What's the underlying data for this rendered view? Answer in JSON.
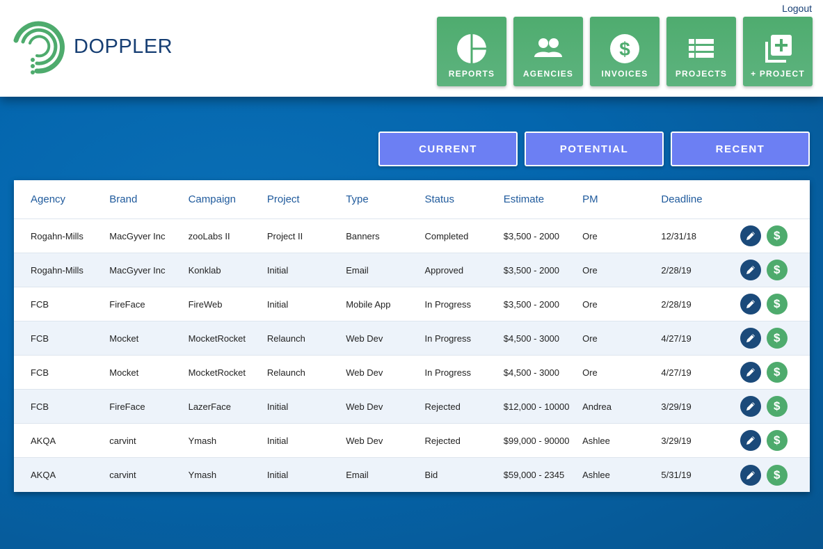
{
  "header": {
    "logout_label": "Logout",
    "logo_text": "DOPPLER",
    "nav": [
      {
        "label": "REPORTS",
        "icon": "pie-chart-icon"
      },
      {
        "label": "AGENCIES",
        "icon": "people-icon"
      },
      {
        "label": "INVOICES",
        "icon": "dollar-icon"
      },
      {
        "label": "PROJECTS",
        "icon": "list-icon"
      },
      {
        "label": "+ PROJECT",
        "icon": "add-project-icon"
      }
    ]
  },
  "tabs": [
    {
      "label": "CURRENT"
    },
    {
      "label": "POTENTIAL"
    },
    {
      "label": "RECENT"
    }
  ],
  "table": {
    "columns": [
      "Agency",
      "Brand",
      "Campaign",
      "Project",
      "Type",
      "Status",
      "Estimate",
      "PM",
      "Deadline"
    ],
    "rows": [
      [
        "Rogahn-Mills",
        "MacGyver Inc",
        "zooLabs II",
        "Project II",
        "Banners",
        "Completed",
        "$3,500 - 2000",
        "Ore",
        "12/31/18"
      ],
      [
        "Rogahn-Mills",
        "MacGyver Inc",
        "Konklab",
        "Initial",
        "Email",
        "Approved",
        "$3,500 - 2000",
        "Ore",
        "2/28/19"
      ],
      [
        "FCB",
        "FireFace",
        "FireWeb",
        "Initial",
        "Mobile App",
        "In Progress",
        "$3,500 - 2000",
        "Ore",
        "2/28/19"
      ],
      [
        "FCB",
        "Mocket",
        "MocketRocket",
        "Relaunch",
        "Web Dev",
        "In Progress",
        "$4,500 - 3000",
        "Ore",
        "4/27/19"
      ],
      [
        "FCB",
        "Mocket",
        "MocketRocket",
        "Relaunch",
        "Web Dev",
        "In Progress",
        "$4,500 - 3000",
        "Ore",
        "4/27/19"
      ],
      [
        "FCB",
        "FireFace",
        "LazerFace",
        "Initial",
        "Web Dev",
        "Rejected",
        "$12,000 - 10000",
        "Andrea",
        "3/29/19"
      ],
      [
        "AKQA",
        "carvint",
        "Ymash",
        "Initial",
        "Web Dev",
        "Rejected",
        "$99,000 - 90000",
        "Ashlee",
        "3/29/19"
      ],
      [
        "AKQA",
        "carvint",
        "Ymash",
        "Initial",
        "Email",
        "Bid",
        "$59,000 - 2345",
        "Ashlee",
        "5/31/19"
      ]
    ],
    "pay_symbol": "$"
  },
  "colors": {
    "brand_navy": "#163e73",
    "nav_green": "#4fac6f",
    "tab_blue": "#6c7ff3",
    "edit_button": "#1b4a7a",
    "pay_button": "#4eab6d"
  }
}
